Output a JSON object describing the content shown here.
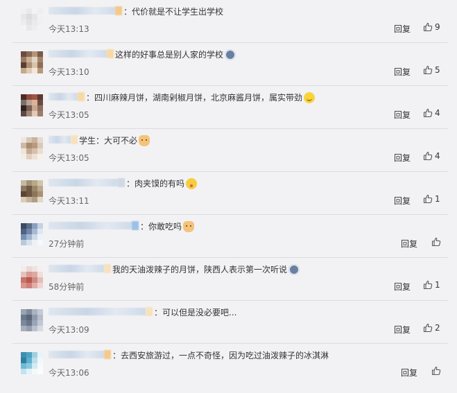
{
  "comments": [
    {
      "text": "：代价就是不让学生出学校",
      "emoji": "",
      "time": "今天13:13",
      "reply_label": "回复",
      "likes": "9",
      "avatar": [
        "#f0f0f2",
        "#e9e9ec",
        "#f3f3f5",
        "#eeeeef",
        "#e7e7ea",
        "#dcdce0",
        "#e6e6e9",
        "#f1f1f3",
        "#ececee",
        "#e2e2e6",
        "#eaeaed",
        "#f0f0f2",
        "#f3f3f5",
        "#e8e8eb",
        "#ededf0",
        "#f2f2f4"
      ],
      "name_width": 96,
      "name_end_color": "#f4c98b"
    },
    {
      "text": "这样的好事总是别人家的学校",
      "emoji": "sad",
      "time": "今天13:10",
      "reply_label": "回复",
      "likes": "5",
      "avatar": [
        "#6b4c3f",
        "#8a6a55",
        "#b49479",
        "#7a5b47",
        "#9b7b63",
        "#c9ae92",
        "#e2d4c3",
        "#a3846b",
        "#59402f",
        "#ad8f74",
        "#d8c3aa",
        "#8d6e57",
        "#c5a88d",
        "#e0cbb3",
        "#f1e6d8",
        "#b6987c"
      ],
      "name_width": 84,
      "name_end_color": "#f7d9a6"
    },
    {
      "text": "：四川麻辣月饼，湖南剁椒月饼，北京麻酱月饼，属实带劲",
      "emoji": "smile",
      "time": "今天13:05",
      "reply_label": "回复",
      "likes": "4",
      "avatar": [
        "#4a2c26",
        "#8e4a3a",
        "#a05444",
        "#5b3a30",
        "#7d6e66",
        "#b9a195",
        "#dab39b",
        "#6b4b3e",
        "#2f2423",
        "#7a5d51",
        "#c7a58e",
        "#8f6e5e",
        "#5e4a43",
        "#a18878",
        "#e3cab6",
        "#9b7e6e"
      ],
      "name_width": 42,
      "name_end_color": "#f7d9a6"
    },
    {
      "text": "学生：大可不必",
      "emoji": "cat",
      "time": "今天13:05",
      "reply_label": "回复",
      "likes": "4",
      "avatar": [
        "#efe6dd",
        "#d8c7b6",
        "#c9b39b",
        "#e6dbcf",
        "#cdb9a4",
        "#a98b70",
        "#b89a80",
        "#dccab8",
        "#efe4d8",
        "#c4ab93",
        "#d6c1ab",
        "#e9ddd0",
        "#f4ede6",
        "#e0d0c0",
        "#eee2d6",
        "#f7f1ea"
      ],
      "name_width": 32,
      "name_end_color": "#f7e2bf"
    },
    {
      "text": "：肉夹馍的有吗",
      "emoji": "yum",
      "time": "今天13:11",
      "reply_label": "回复",
      "likes": "1",
      "avatar": [
        "#c7b9a0",
        "#a3927a",
        "#b8a88c",
        "#d2c4ab",
        "#8a7860",
        "#6e5a42",
        "#9a866b",
        "#bba98d",
        "#5a4432",
        "#6e5640",
        "#8d755a",
        "#a89176",
        "#d9ccb8",
        "#c3b39b",
        "#b09d83",
        "#e2d8c6"
      ],
      "name_width": 100,
      "name_end_color": "#cfd8e3"
    },
    {
      "text": "：你敢吃吗",
      "emoji": "cat",
      "time": "27分钟前",
      "reply_label": "回复",
      "likes": "",
      "avatar": [
        "#3a4a63",
        "#5a6c88",
        "#8aa0bf",
        "#c5d2e3",
        "#4e6282",
        "#6f86a8",
        "#a7bad3",
        "#dfe7f1",
        "#7890b2",
        "#9fb4cf",
        "#cfdbe9",
        "#eef2f7",
        "#b9c8dc",
        "#d7e1ee",
        "#edf1f6",
        "#f6f8fb"
      ],
      "name_width": 120,
      "name_end_color": "#9cc1e6"
    },
    {
      "text": "我的天油泼辣子的月饼，陕西人表示第一次听说",
      "emoji": "sad",
      "time": "58分钟前",
      "reply_label": "回复",
      "likes": "1",
      "avatar": [
        "#f2ecea",
        "#e9d9d6",
        "#efe3e1",
        "#f5efee",
        "#e2c4bf",
        "#d79c94",
        "#dea9a2",
        "#efdfdc",
        "#c9726a",
        "#b85a52",
        "#d18a82",
        "#e4bdb7",
        "#d89790",
        "#cf8078",
        "#e2aea8",
        "#efd5d1"
      ],
      "name_width": 80,
      "name_end_color": "#f7e2bf"
    },
    {
      "text": "：可以但是没必要吧...",
      "emoji": "",
      "time": "今天13:09",
      "reply_label": "回复",
      "likes": "2",
      "avatar": [
        "#9aa3b3",
        "#7f8a9d",
        "#aab3c2",
        "#c4cbd6",
        "#6c788c",
        "#5a667a",
        "#8e99ab",
        "#b5bdca",
        "#7d889b",
        "#697589",
        "#9ba5b6",
        "#c1c8d3",
        "#a6afbe",
        "#939eaf",
        "#b9c1cd",
        "#d6dbe3"
      ],
      "name_width": 140,
      "name_end_color": "#f7e2bf"
    },
    {
      "text": "：去西安旅游过，一点不奇怪，因为吃过油泼辣子的冰淇淋",
      "emoji": "",
      "time": "今天13:06",
      "reply_label": "回复",
      "likes": "",
      "avatar": [
        "#3d8fb0",
        "#4ea3c2",
        "#9fd0e2",
        "#e8f3f7",
        "#2f7fa3",
        "#5db1cf",
        "#b8dfec",
        "#f0f7fa",
        "#6fbad4",
        "#8bc8dd",
        "#d3ebf3",
        "#f6fafc",
        "#c2e3ee",
        "#e3f2f7",
        "#f3f9fb",
        "#fafcfd"
      ],
      "name_width": 80,
      "name_end_color": "#f4c98b"
    }
  ]
}
